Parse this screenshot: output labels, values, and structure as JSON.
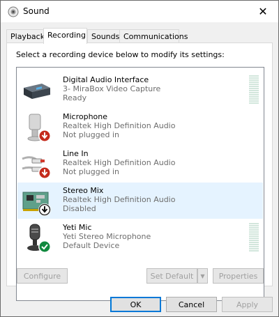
{
  "window": {
    "title": "Sound",
    "close_glyph": "✕"
  },
  "tabs": [
    {
      "label": "Playback"
    },
    {
      "label": "Recording"
    },
    {
      "label": "Sounds"
    },
    {
      "label": "Communications"
    }
  ],
  "active_tab": "Recording",
  "instruction": "Select a recording device below to modify its settings:",
  "devices": [
    {
      "name": "Digital Audio Interface",
      "line1": "3- MiraBox Video Capture",
      "line2": "Ready",
      "icon": "capture-device-icon",
      "status_icon": "",
      "has_level_meter": true
    },
    {
      "name": "Microphone",
      "line1": "Realtek High Definition Audio",
      "line2": "Not plugged in",
      "icon": "microphone-icon",
      "status_icon": "not-plugged-in-icon",
      "has_level_meter": false
    },
    {
      "name": "Line In",
      "line1": "Realtek High Definition Audio",
      "line2": "Not plugged in",
      "icon": "line-in-icon",
      "status_icon": "not-plugged-in-icon",
      "has_level_meter": false
    },
    {
      "name": "Stereo Mix",
      "line1": "Realtek High Definition Audio",
      "line2": "Disabled",
      "icon": "sound-card-icon",
      "status_icon": "disabled-icon",
      "has_level_meter": false,
      "selected": true
    },
    {
      "name": "Yeti Mic",
      "line1": "Yeti Stereo Microphone",
      "line2": "Default Device",
      "icon": "usb-microphone-icon",
      "status_icon": "default-device-check-icon",
      "has_level_meter": true
    }
  ],
  "buttons": {
    "configure": "Configure",
    "set_default": "Set Default",
    "properties": "Properties",
    "ok": "OK",
    "cancel": "Cancel",
    "apply": "Apply"
  },
  "colors": {
    "selection": "#e5f3ff",
    "focus_border": "#0078d7",
    "status_red": "#d83b01",
    "status_green": "#10893e"
  }
}
